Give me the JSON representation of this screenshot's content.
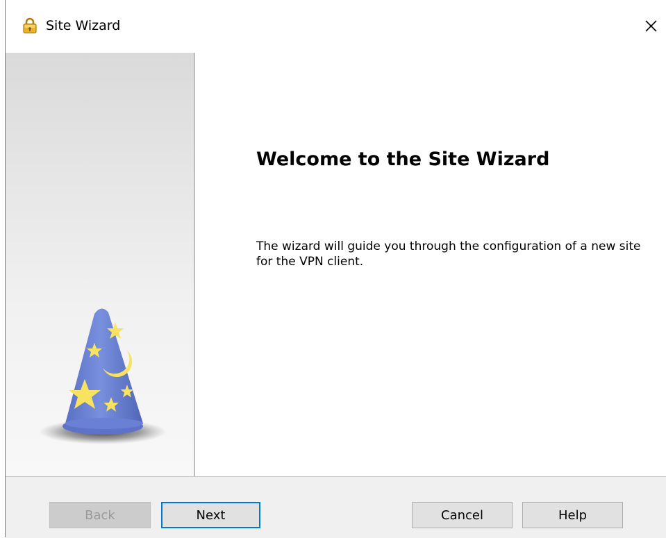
{
  "window": {
    "title": "Site Wizard",
    "close_glyph": "✕",
    "title_icon": "lock-icon",
    "close_icon": "close-icon"
  },
  "sidebar": {
    "image": "wizard-hat-icon"
  },
  "content": {
    "heading": "Welcome to the Site Wizard",
    "description": "The wizard will guide you through the configuration of a new site for the VPN client."
  },
  "buttons": {
    "back": "Back",
    "next": "Next",
    "cancel": "Cancel",
    "help": "Help"
  },
  "colors": {
    "focus_border": "#0078d7",
    "hat_body": "#6f86d6",
    "hat_stars": "#f7e35f",
    "lock_gold": "#e9b12d"
  }
}
